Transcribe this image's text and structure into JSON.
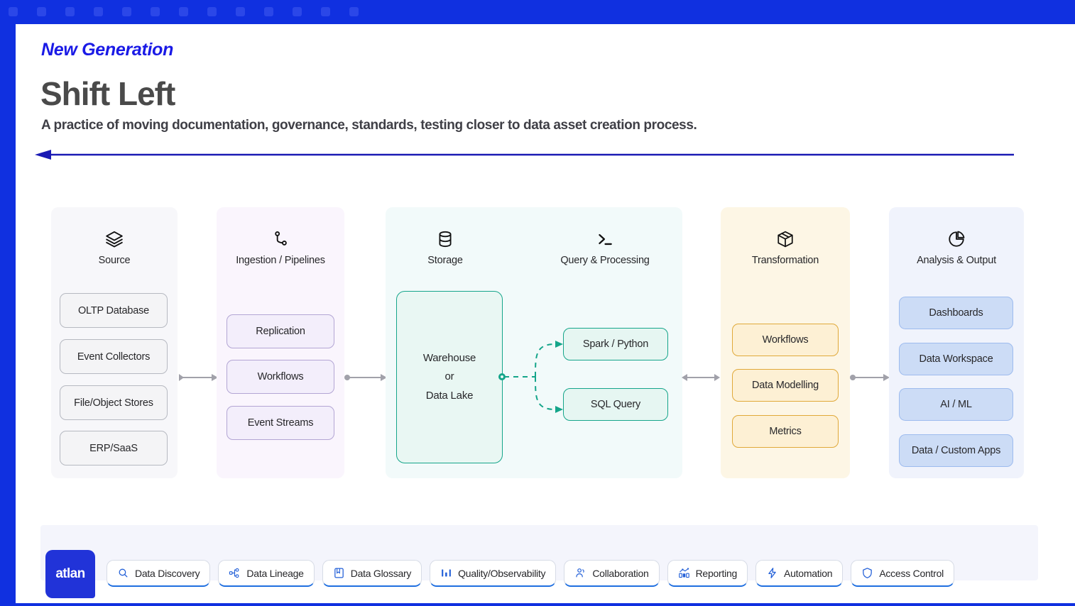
{
  "theme": {
    "brand_blue": "#1030e0",
    "logo_blue": "#2133d8",
    "arrow_navy": "#1a1ab4",
    "teal": "#15a58a",
    "amber": "#e0a93a",
    "purple": "#b3a5d4",
    "blue_chip": "#9dbbee"
  },
  "header": {
    "eyebrow": "New Generation",
    "title": "Shift Left",
    "subtitle": "A practice of moving documentation, governance, standards, testing closer to data asset creation process."
  },
  "stages": [
    {
      "key": "source",
      "label": "Source",
      "icon": "layers-icon",
      "variant": "gray",
      "items": [
        "OLTP Database",
        "Event Collectors",
        "File/Object Stores",
        "ERP/SaaS"
      ]
    },
    {
      "key": "ingestion",
      "label": "Ingestion / Pipelines",
      "icon": "git-branch-icon",
      "variant": "purple",
      "items": [
        "Replication",
        "Workflows",
        "Event Streams"
      ]
    },
    {
      "key": "storage",
      "label": "Storage",
      "icon": "database-icon",
      "variant": "teal",
      "items": [
        "Warehouse\nor\nData Lake"
      ]
    },
    {
      "key": "query",
      "label": "Query & Processing",
      "icon": "terminal-icon",
      "variant": "teal",
      "items": [
        "Spark / Python",
        "SQL Query"
      ]
    },
    {
      "key": "transformation",
      "label": "Transformation",
      "icon": "cube-icon",
      "variant": "amber",
      "items": [
        "Workflows",
        "Data Modelling",
        "Metrics"
      ]
    },
    {
      "key": "analysis",
      "label": "Analysis & Output",
      "icon": "pie-chart-icon",
      "variant": "blue",
      "items": [
        "Dashboards",
        "Data Workspace",
        "AI / ML",
        "Data / Custom Apps"
      ]
    }
  ],
  "warehouse": {
    "line1": "Warehouse",
    "line2": "or",
    "line3": "Data Lake"
  },
  "footer": {
    "logo_text": "atlan",
    "tools": [
      {
        "label": "Data Discovery",
        "icon": "search-icon"
      },
      {
        "label": "Data Lineage",
        "icon": "lineage-icon"
      },
      {
        "label": "Data Glossary",
        "icon": "book-icon"
      },
      {
        "label": "Quality/Observability",
        "icon": "bar-chart-icon"
      },
      {
        "label": "Collaboration",
        "icon": "users-icon"
      },
      {
        "label": "Reporting",
        "icon": "report-icon"
      },
      {
        "label": "Automation",
        "icon": "bolt-icon"
      },
      {
        "label": "Access Control",
        "icon": "shield-icon"
      }
    ]
  }
}
